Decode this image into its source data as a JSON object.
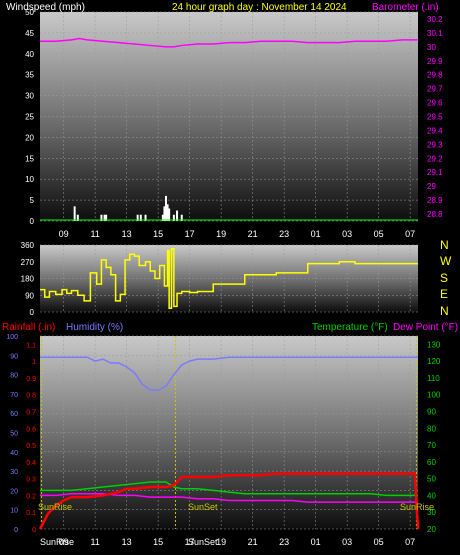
{
  "colors": {
    "wind": "#ffffff",
    "baro": "#ff00ff",
    "title": "#ffff00",
    "dir": "#ffff00",
    "rain": "#ff0000",
    "hum": "#7b7bff",
    "temp": "#00d000",
    "dew": "#ff00ff",
    "solar": "#c8c800",
    "axis": "#ffffff"
  },
  "header": {
    "wind_label": "Windspeed (mph)",
    "title": "24 hour graph day : November 14 2024",
    "baro_label": "Barometer (.in)"
  },
  "lower_header": {
    "rain_label": "Rainfall (.in)",
    "hum_label": "Humidity (%)",
    "temp_label": "Temperature (°F)",
    "dew_label": "Dew Point (°F)"
  },
  "compass": [
    "N",
    "W",
    "S",
    "E",
    "N"
  ],
  "x_ticks": [
    "09",
    "11",
    "13",
    "15",
    "17",
    "19",
    "21",
    "23",
    "01",
    "03",
    "05",
    "07"
  ],
  "sun_labels": {
    "sunrise": "SunRise",
    "sunset": "SunSet",
    "sunrise2": "SunRise"
  },
  "chart_data": [
    {
      "type": "line",
      "title": "24 hour graph day : November 14 2024",
      "x_unit": "hours since 07:30",
      "series": [
        {
          "name": "Windspeed (mph)",
          "axis": "left",
          "style": "bar",
          "x": [
            2.2,
            2.4,
            3.9,
            4.1,
            4.2,
            6.2,
            6.4,
            6.7,
            7.8,
            7.9,
            8.0,
            8.1,
            8.2,
            8.5,
            8.7,
            9.0
          ],
          "values": [
            3.5,
            1.5,
            1.5,
            1.5,
            1.5,
            1.5,
            1.5,
            1.5,
            1.5,
            3.5,
            6,
            4,
            3,
            1.5,
            2.5,
            1.5
          ]
        },
        {
          "name": "Barometer (.in)",
          "axis": "right",
          "x": [
            0,
            1,
            2,
            2.5,
            3,
            4,
            5,
            6,
            7,
            8,
            8.5,
            9,
            10,
            11,
            12,
            13,
            14,
            15,
            16,
            17,
            18,
            19,
            20,
            21,
            22,
            23,
            24
          ],
          "values": [
            30.04,
            30.04,
            30.05,
            30.06,
            30.05,
            30.04,
            30.03,
            30.02,
            30.01,
            30.0,
            30.0,
            30.01,
            30.02,
            30.02,
            30.03,
            30.03,
            30.04,
            30.04,
            30.04,
            30.03,
            30.03,
            30.03,
            30.04,
            30.04,
            30.04,
            30.05,
            30.05
          ]
        }
      ],
      "y_left": {
        "ticks": [
          0,
          5,
          10,
          15,
          20,
          25,
          30,
          35,
          40,
          45,
          50
        ],
        "range": [
          0,
          50
        ]
      },
      "y_right": {
        "ticks": [
          "28.8",
          "28.9",
          "29",
          "29.1",
          "29.2",
          "29.3",
          "29.4",
          "29.5",
          "29.6",
          "29.7",
          "29.8",
          "29.9",
          "30",
          "30.1",
          "30.2"
        ],
        "range": [
          28.75,
          30.25
        ]
      }
    },
    {
      "type": "line",
      "title": "",
      "series": [
        {
          "name": "Wind direction",
          "x": [
            0,
            0.3,
            0.6,
            1,
            1.4,
            1.7,
            2,
            2.4,
            2.8,
            3.2,
            3.6,
            3.9,
            4.2,
            4.5,
            4.8,
            5.1,
            5.4,
            5.7,
            6,
            6.3,
            6.7,
            7,
            7.3,
            7.6,
            7.9,
            8.1,
            8.2,
            8.35,
            8.5,
            8.7,
            9,
            9.5,
            10,
            11,
            12,
            13,
            14,
            15,
            16,
            17,
            18,
            19,
            20,
            21,
            22,
            23,
            24
          ],
          "values": [
            120,
            80,
            110,
            95,
            120,
            100,
            115,
            90,
            60,
            210,
            150,
            280,
            240,
            200,
            60,
            95,
            280,
            310,
            300,
            250,
            270,
            220,
            180,
            250,
            140,
            330,
            20,
            340,
            30,
            100,
            110,
            105,
            110,
            150,
            150,
            200,
            200,
            210,
            210,
            260,
            260,
            270,
            260,
            260,
            260,
            260,
            260
          ]
        }
      ],
      "y_left": {
        "ticks": [
          0,
          90,
          180,
          270,
          360
        ],
        "range": [
          0,
          360
        ]
      }
    },
    {
      "type": "line",
      "title": "",
      "series": [
        {
          "name": "Rainfall (.in)",
          "axis": "rain",
          "x": [
            0,
            0.5,
            1,
            1.5,
            2,
            3,
            4,
            5,
            5.5,
            6,
            7,
            8,
            8.5,
            9,
            10,
            11,
            12,
            13,
            14,
            15,
            16,
            17,
            18,
            19,
            20,
            21,
            22,
            23,
            23.8,
            24
          ],
          "values": [
            0,
            0.09,
            0.14,
            0.17,
            0.19,
            0.19,
            0.2,
            0.22,
            0.24,
            0.24,
            0.25,
            0.25,
            0.26,
            0.31,
            0.31,
            0.31,
            0.32,
            0.32,
            0.32,
            0.33,
            0.33,
            0.33,
            0.33,
            0.33,
            0.33,
            0.33,
            0.33,
            0.33,
            0.33,
            0
          ]
        },
        {
          "name": "Humidity (%)",
          "axis": "hum",
          "x": [
            0,
            1,
            2,
            3,
            3.5,
            4,
            4.5,
            5,
            5.5,
            6,
            6.5,
            7,
            7.5,
            8,
            8.5,
            9,
            9.5,
            10,
            11,
            12,
            13,
            14,
            15,
            16,
            17,
            18,
            19,
            20,
            21,
            22,
            23,
            24
          ],
          "values": [
            89,
            89,
            89,
            89,
            87,
            88,
            86,
            86,
            84,
            81,
            75,
            72,
            72,
            74,
            80,
            85,
            87,
            88,
            88,
            89,
            89,
            89,
            89,
            89,
            89,
            89,
            89,
            89,
            89,
            89,
            89,
            89
          ]
        },
        {
          "name": "Temperature (°F)",
          "axis": "temp",
          "x": [
            0,
            1,
            2,
            3,
            4,
            5,
            6,
            7,
            8,
            8.5,
            9,
            10,
            11,
            12,
            13,
            14,
            15,
            16,
            17,
            18,
            19,
            20,
            21,
            22,
            23,
            24
          ],
          "values": [
            43,
            43,
            43,
            44,
            45,
            46,
            47,
            48,
            48,
            45,
            44,
            44,
            43,
            42,
            41,
            41,
            41,
            41,
            41,
            41,
            41,
            41,
            41,
            40,
            40,
            40
          ]
        },
        {
          "name": "Dew Point (°F)",
          "axis": "temp",
          "x": [
            0,
            1,
            2,
            3,
            4,
            5,
            6,
            7,
            8,
            9,
            10,
            11,
            12,
            13,
            14,
            15,
            16,
            17,
            18,
            19,
            20,
            21,
            22,
            23,
            24
          ],
          "values": [
            40,
            40,
            41,
            41,
            41,
            40,
            40,
            39,
            39,
            39,
            38,
            38,
            37,
            37,
            37,
            37,
            37,
            36,
            36,
            36,
            36,
            36,
            36,
            36,
            36
          ]
        }
      ],
      "y_hum": {
        "ticks": [
          0,
          10,
          20,
          30,
          40,
          50,
          60,
          70,
          80,
          90,
          100
        ],
        "range": [
          0,
          100
        ]
      },
      "y_rain": {
        "ticks": [
          "0",
          "0.1",
          "0.2",
          "0.3",
          "0.4",
          "0.5",
          "0.6",
          "0.7",
          "0.8",
          "0.9",
          "1",
          "1.1"
        ],
        "range": [
          0,
          1.15
        ]
      },
      "y_temp": {
        "ticks": [
          20,
          30,
          40,
          50,
          60,
          70,
          80,
          90,
          100,
          110,
          120,
          130
        ],
        "range": [
          20,
          135
        ]
      }
    }
  ]
}
